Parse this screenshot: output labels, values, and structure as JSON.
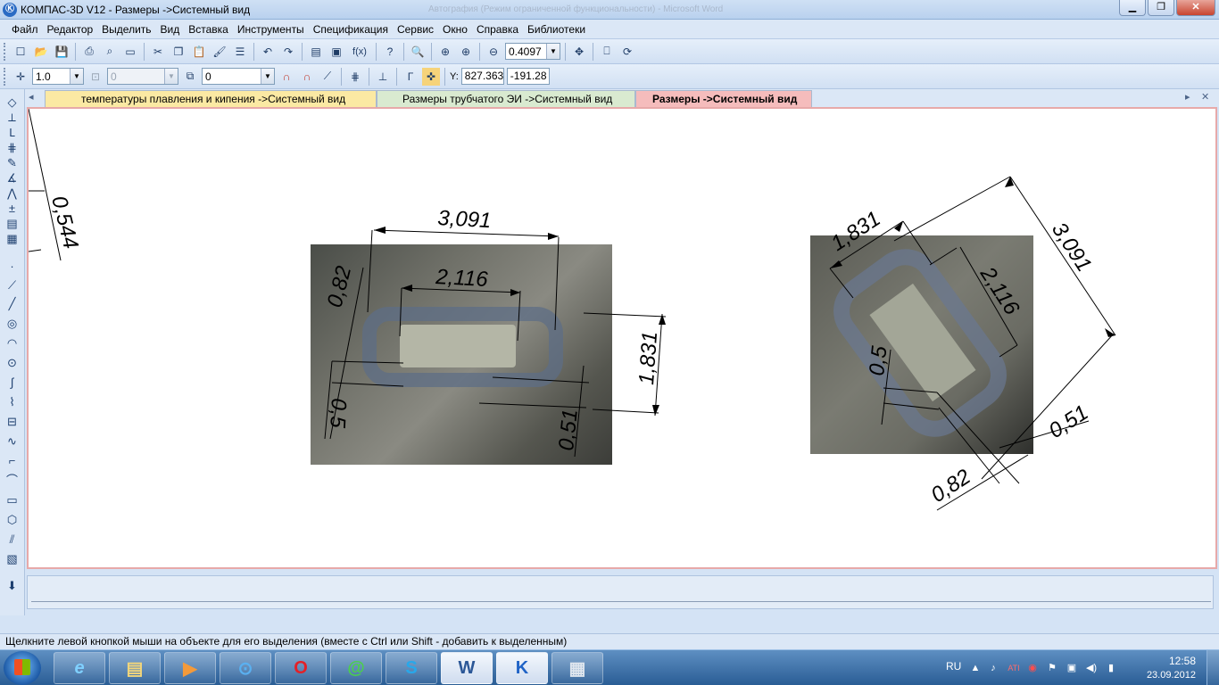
{
  "window": {
    "app_icon": "Ⓚ",
    "title": "КОМПАС-3D V12 - Размеры ->Системный вид",
    "background_title": "Автография (Режим ограниченной функциональности) - Microsoft Word",
    "controls": {
      "minimize": "▁",
      "maximize": "❐",
      "close": "✕"
    }
  },
  "menu": [
    "Файл",
    "Редактор",
    "Выделить",
    "Вид",
    "Вставка",
    "Инструменты",
    "Спецификация",
    "Сервис",
    "Окно",
    "Справка",
    "Библиотеки"
  ],
  "toolbar1": {
    "icons": [
      "new-icon",
      "open-icon",
      "save-icon",
      "print-icon",
      "print-preview-icon",
      "copy-icon",
      "cut-icon",
      "paste-icon",
      "brush-icon",
      "properties-icon",
      "undo-icon",
      "redo-icon",
      "manager-icon",
      "variables-icon",
      "fx-icon",
      "help-icon",
      "zoom-icon",
      "zoom-in-icon",
      "zoom-window-icon",
      "zoom-out-icon",
      "pan-icon",
      "refresh-icon"
    ],
    "fx_label": "f(x)",
    "zoom_value": "0.4097"
  },
  "toolbar2": {
    "step_value": "1.0",
    "angle_value": "0",
    "layer_value": "0",
    "coord_x_label": "Y:",
    "coord_x": "827.363",
    "coord_y": "-191.28"
  },
  "tabs": [
    {
      "label": "температуры плавления и кипения ->Системный вид",
      "color": "#fbe9a3"
    },
    {
      "label": "Размеры трубчатого ЭИ ->Системный вид",
      "color": "#d9ead0"
    },
    {
      "label": "Размеры ->Системный вид",
      "color": "#f5bcbc",
      "active": true
    }
  ],
  "tab_nav": {
    "left": "◂",
    "right": "▸",
    "close": "✕"
  },
  "left_tools": [
    "geometry-icon",
    "dimensions-icon",
    "symbols-icon",
    "editing-icon",
    "parametrization-icon",
    "measure-icon",
    "select-icon",
    "specification-icon",
    "reports-icon",
    "insert-icon",
    "point-icon",
    "segment-icon",
    "arc-icon",
    "circle-icon",
    "ellipse-icon",
    "polyline-icon",
    "spline-icon",
    "auxiliary-line-icon",
    "hatch-icon",
    "curve-icon",
    "chamfer-icon",
    "fillet-icon",
    "rectangle-icon",
    "polygon-icon",
    "equidistant-icon",
    "fill-icon"
  ],
  "drawing": {
    "left_edge_dim": "0,544",
    "view1": {
      "d_3091": "3,091",
      "d_2116": "2,116",
      "d_082": "0,82",
      "d_1831": "1,831",
      "d_05": "0,5",
      "d_051": "0,51"
    },
    "view2": {
      "d_1831": "1,831",
      "d_3091": "3,091",
      "d_2116": "2,116",
      "d_05": "0,5",
      "d_051": "0,51",
      "d_082": "0,82"
    }
  },
  "status": "Щелкните левой кнопкой мыши на объекте для его выделения (вместе с Ctrl или Shift - добавить к выделенным)",
  "taskbar": {
    "apps": [
      {
        "name": "ie",
        "glyph": "e"
      },
      {
        "name": "explorer",
        "glyph": "▤"
      },
      {
        "name": "media",
        "glyph": "▶"
      },
      {
        "name": "portal",
        "glyph": "⊙"
      },
      {
        "name": "opera",
        "glyph": "O"
      },
      {
        "name": "icq",
        "glyph": "@"
      },
      {
        "name": "skype",
        "glyph": "S"
      },
      {
        "name": "word",
        "glyph": "W"
      },
      {
        "name": "kompas",
        "glyph": "K"
      },
      {
        "name": "calculator",
        "glyph": "▦"
      }
    ],
    "lang": "RU",
    "tray_icons": [
      "▲",
      "♪",
      "ATI",
      "◉",
      "⚑",
      "▣",
      "◀)",
      "▮"
    ],
    "time": "12:58",
    "date": "23.09.2012"
  }
}
